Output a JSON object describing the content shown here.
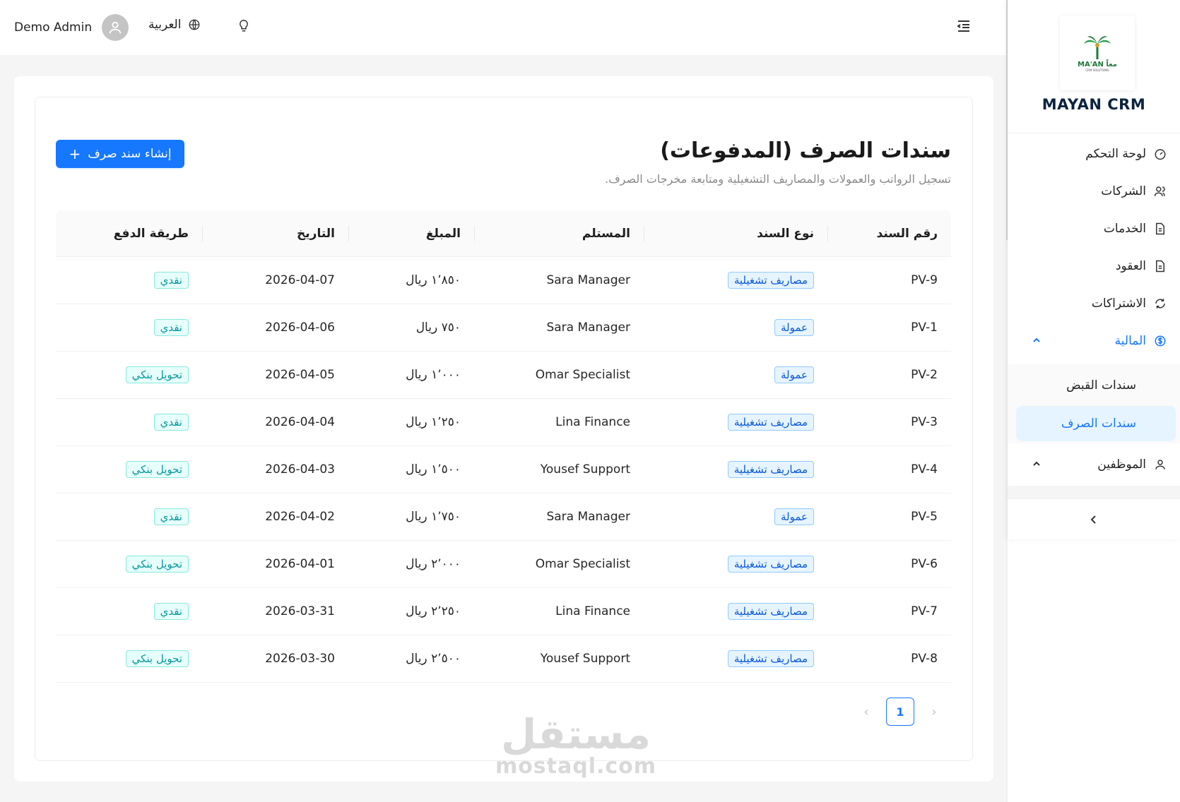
{
  "header": {
    "user_name": "Demo Admin",
    "language": "العربية"
  },
  "page": {
    "title": "سندات الصرف (المدفوعات)",
    "subtitle": "تسجيل الرواتب والعمولات والمصاريف التشغيلية ومتابعة مخرجات الصرف.",
    "create_button": "إنشاء سند صرف"
  },
  "table": {
    "columns": [
      "رقم السند",
      "نوع السند",
      "المستلم",
      "المبلغ",
      "التاريخ",
      "طريقة الدفع"
    ],
    "rows": [
      {
        "no": "PV-9",
        "type": "مصاريف تشغيلية",
        "recipient": "Sara Manager",
        "amount": "١٬٨٥٠ ريال",
        "date": "2026-04-07",
        "method": "نقدي"
      },
      {
        "no": "PV-1",
        "type": "عمولة",
        "recipient": "Sara Manager",
        "amount": "٧٥٠ ريال",
        "date": "2026-04-06",
        "method": "نقدي"
      },
      {
        "no": "PV-2",
        "type": "عمولة",
        "recipient": "Omar Specialist",
        "amount": "١٬٠٠٠ ريال",
        "date": "2026-04-05",
        "method": "تحويل بنكي"
      },
      {
        "no": "PV-3",
        "type": "مصاريف تشغيلية",
        "recipient": "Lina Finance",
        "amount": "١٬٢٥٠ ريال",
        "date": "2026-04-04",
        "method": "نقدي"
      },
      {
        "no": "PV-4",
        "type": "مصاريف تشغيلية",
        "recipient": "Yousef Support",
        "amount": "١٬٥٠٠ ريال",
        "date": "2026-04-03",
        "method": "تحويل بنكي"
      },
      {
        "no": "PV-5",
        "type": "عمولة",
        "recipient": "Sara Manager",
        "amount": "١٬٧٥٠ ريال",
        "date": "2026-04-02",
        "method": "نقدي"
      },
      {
        "no": "PV-6",
        "type": "مصاريف تشغيلية",
        "recipient": "Omar Specialist",
        "amount": "٢٬٠٠٠ ريال",
        "date": "2026-04-01",
        "method": "تحويل بنكي"
      },
      {
        "no": "PV-7",
        "type": "مصاريف تشغيلية",
        "recipient": "Lina Finance",
        "amount": "٢٬٢٥٠ ريال",
        "date": "2026-03-31",
        "method": "نقدي"
      },
      {
        "no": "PV-8",
        "type": "مصاريف تشغيلية",
        "recipient": "Yousef Support",
        "amount": "٢٬٥٠٠ ريال",
        "date": "2026-03-30",
        "method": "تحويل بنكي"
      }
    ]
  },
  "pagination": {
    "current": "1"
  },
  "watermark": {
    "arabic": "مستقل",
    "latin": "mostaql.com"
  },
  "sidebar": {
    "logo_text": "MA'AN معاً",
    "logo_sub": "CRM SOLUTIONS",
    "brand": "MAYAN CRM",
    "items": [
      {
        "label": "لوحة التحكم",
        "icon": "dashboard-icon"
      },
      {
        "label": "الشركات",
        "icon": "users-icon"
      },
      {
        "label": "الخدمات",
        "icon": "file-icon"
      },
      {
        "label": "العقود",
        "icon": "file-icon"
      },
      {
        "label": "الاشتراكات",
        "icon": "sync-icon"
      },
      {
        "label": "المالية",
        "icon": "dollar-icon"
      }
    ],
    "finance_sub": [
      "سندات القبض",
      "سندات الصرف"
    ],
    "employees": "الموظفين"
  },
  "colors": {
    "primary": "#1677ff",
    "tag_blue_bg": "#e6f4ff",
    "tag_cyan_bg": "#e6fffb",
    "brand_dark": "#0c2340",
    "logo_green": "#1e7a3c"
  }
}
